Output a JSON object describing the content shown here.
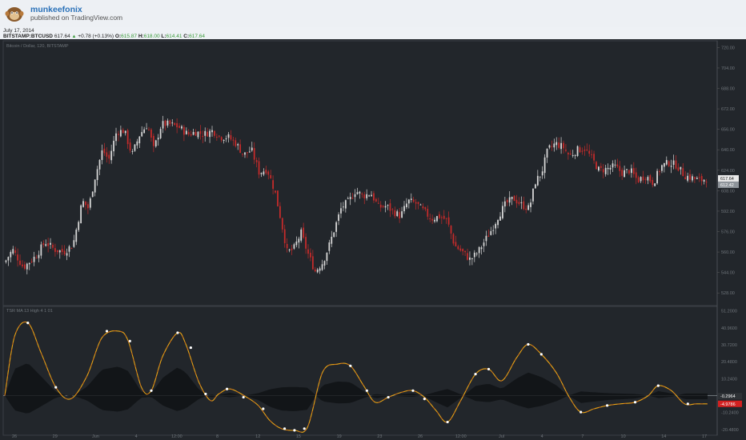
{
  "header": {
    "author": "munkeefonix",
    "published": "published on TradingView.com",
    "date": "July 17, 2014"
  },
  "quote": {
    "symbol": "BITSTAMP:BTCUSD",
    "last": "617.64",
    "change": "+0.78 (+0.13%)",
    "o_label": "O:",
    "o": "615.87",
    "h_label": "H:",
    "h": "618.00",
    "l_label": "L:",
    "l": "614.41",
    "c_label": "C:",
    "c": "617.64"
  },
  "colors": {
    "background": "#22262b",
    "up_candle": "#d6d6d6",
    "down_candle": "#c42b2b",
    "indicator_line": "#e8a415",
    "indicator_marker": "#ffffff",
    "price_tag": "#e9e9e9",
    "negative_tag": "#d22020"
  },
  "chart_data": [
    {
      "type": "candlestick",
      "title": "Bitcoin / Dollar, 120, BITSTAMP",
      "y_tick_labels": [
        "720.00",
        "704.00",
        "688.00",
        "672.00",
        "656.00",
        "640.00",
        "624.00",
        "608.00",
        "592.00",
        "576.00",
        "560.00",
        "544.00",
        "528.00"
      ],
      "ylim": [
        520,
        724
      ],
      "last_price_label": "617.64",
      "secondary_price_label": "612.42",
      "x_tick_labels": [
        "26",
        "29",
        "Jun",
        "4",
        "12:00",
        "8",
        "12",
        "15",
        "19",
        "23",
        "26",
        "12:00",
        "Jul",
        "4",
        "7",
        "10",
        "14",
        "17"
      ],
      "close_path": [
        [
          0,
          552
        ],
        [
          0.5,
          562
        ],
        [
          1.2,
          548
        ],
        [
          2,
          557
        ],
        [
          2.6,
          568
        ],
        [
          3.2,
          562
        ],
        [
          3.8,
          560
        ],
        [
          4.4,
          566
        ],
        [
          5,
          600
        ],
        [
          5.4,
          594
        ],
        [
          5.8,
          618
        ],
        [
          6.3,
          640
        ],
        [
          6.7,
          632
        ],
        [
          7.2,
          654
        ],
        [
          7.7,
          655
        ],
        [
          8.2,
          636
        ],
        [
          8.7,
          652
        ],
        [
          9.2,
          660
        ],
        [
          9.6,
          640
        ],
        [
          10.1,
          660
        ],
        [
          10.6,
          660
        ],
        [
          11.2,
          658
        ],
        [
          11.8,
          652
        ],
        [
          12.3,
          654
        ],
        [
          12.8,
          652
        ],
        [
          13.4,
          655
        ],
        [
          13.9,
          650
        ],
        [
          14.4,
          650
        ],
        [
          14.9,
          645
        ],
        [
          15.4,
          636
        ],
        [
          15.9,
          640
        ],
        [
          16.4,
          622
        ],
        [
          16.9,
          625
        ],
        [
          17.4,
          608
        ],
        [
          17.8,
          585
        ],
        [
          18.2,
          560
        ],
        [
          18.6,
          562
        ],
        [
          19.1,
          575
        ],
        [
          19.5,
          560
        ],
        [
          20,
          545
        ],
        [
          20.5,
          552
        ],
        [
          20.9,
          565
        ],
        [
          21.3,
          580
        ],
        [
          21.7,
          595
        ],
        [
          22.2,
          600
        ],
        [
          22.6,
          608
        ],
        [
          23.1,
          604
        ],
        [
          23.6,
          606
        ],
        [
          24.1,
          595
        ],
        [
          24.6,
          596
        ],
        [
          25,
          592
        ],
        [
          25.5,
          588
        ],
        [
          26,
          600
        ],
        [
          26.5,
          598
        ],
        [
          27,
          592
        ],
        [
          27.5,
          586
        ],
        [
          28,
          588
        ],
        [
          28.5,
          585
        ],
        [
          29,
          565
        ],
        [
          29.5,
          560
        ],
        [
          30,
          554
        ],
        [
          30.5,
          560
        ],
        [
          30.9,
          568
        ],
        [
          31.4,
          578
        ],
        [
          31.8,
          588
        ],
        [
          32.3,
          598
        ],
        [
          32.8,
          602
        ],
        [
          33.3,
          597
        ],
        [
          33.8,
          594
        ],
        [
          34.2,
          615
        ],
        [
          34.6,
          622
        ],
        [
          35,
          640
        ],
        [
          35.5,
          645
        ],
        [
          36,
          642
        ],
        [
          36.4,
          635
        ],
        [
          36.9,
          640
        ],
        [
          37.4,
          641
        ],
        [
          37.9,
          632
        ],
        [
          38.3,
          624
        ],
        [
          38.8,
          625
        ],
        [
          39.3,
          627
        ],
        [
          39.8,
          622
        ],
        [
          40.3,
          624
        ],
        [
          40.8,
          616
        ],
        [
          41.3,
          620
        ],
        [
          41.8,
          614
        ],
        [
          42.3,
          627
        ],
        [
          42.8,
          630
        ],
        [
          43.3,
          628
        ],
        [
          43.8,
          620
        ],
        [
          44.3,
          618
        ],
        [
          44.8,
          616
        ],
        [
          45.3,
          617.64
        ]
      ],
      "annotations": [
        "Bitcoin / Dollar, 120, BITSTAMP"
      ]
    },
    {
      "type": "line",
      "title": "TSR MA 13 High 4 1 01",
      "y_tick_labels": [
        "51.2000",
        "40.9600",
        "30.7200",
        "20.4800",
        "10.2400",
        "0.0000",
        "-10.2400",
        "-20.4800"
      ],
      "ylim": [
        -23.0,
        53.0
      ],
      "last_value_label": "-0.2964",
      "secondary_value_label": "-4.9786",
      "series": [
        {
          "values": [
            [
              0,
              0
            ],
            [
              0.6,
              36
            ],
            [
              1.4,
              44
            ],
            [
              2.2,
              26
            ],
            [
              3.1,
              5
            ],
            [
              4,
              -2
            ],
            [
              5.0,
              12
            ],
            [
              5.9,
              35
            ],
            [
              6.9,
              39
            ],
            [
              7.5,
              33
            ],
            [
              8.3,
              5
            ],
            [
              8.9,
              3
            ],
            [
              9.6,
              24
            ],
            [
              10.5,
              38
            ],
            [
              11,
              31
            ],
            [
              11.8,
              8
            ],
            [
              12.5,
              -3
            ],
            [
              13,
              1
            ],
            [
              13.7,
              4
            ],
            [
              14.7,
              -1
            ],
            [
              15.4,
              -6
            ],
            [
              16.1,
              -15
            ],
            [
              16.8,
              -20
            ],
            [
              17.6,
              -21
            ],
            [
              18.4,
              -19
            ],
            [
              19.3,
              14
            ],
            [
              20.2,
              19
            ],
            [
              21,
              18
            ],
            [
              21.8,
              6
            ],
            [
              22.5,
              -4
            ],
            [
              23.3,
              -1
            ],
            [
              24.1,
              2
            ],
            [
              24.8,
              3
            ],
            [
              25.5,
              -1
            ],
            [
              26.2,
              -9
            ],
            [
              26.9,
              -16
            ],
            [
              27.7,
              -3
            ],
            [
              28.6,
              13
            ],
            [
              29.4,
              16
            ],
            [
              30.2,
              9
            ],
            [
              31.1,
              23
            ],
            [
              31.8,
              31
            ],
            [
              32.6,
              25
            ],
            [
              33.5,
              14
            ],
            [
              34.3,
              -1
            ],
            [
              35,
              -10
            ],
            [
              35.8,
              -8
            ],
            [
              36.6,
              -6
            ],
            [
              37.4,
              -5
            ],
            [
              38.3,
              -4
            ],
            [
              39.1,
              0
            ],
            [
              39.7,
              6
            ],
            [
              40.5,
              3
            ],
            [
              41.3,
              -5
            ],
            [
              42,
              -5
            ],
            [
              42.7,
              -4.98
            ]
          ],
          "markers": [
            [
              1.4,
              44
            ],
            [
              3.1,
              5
            ],
            [
              6.2,
              39
            ],
            [
              7.6,
              33
            ],
            [
              8.9,
              3
            ],
            [
              10.5,
              38
            ],
            [
              11.3,
              29
            ],
            [
              12.2,
              1
            ],
            [
              13.5,
              4
            ],
            [
              14.5,
              -1
            ],
            [
              15.7,
              -8
            ],
            [
              17,
              -20
            ],
            [
              17.6,
              -21
            ],
            [
              18.2,
              -20
            ],
            [
              21,
              18
            ],
            [
              22,
              3
            ],
            [
              23.3,
              -1
            ],
            [
              24.8,
              3
            ],
            [
              25.5,
              -2
            ],
            [
              26.9,
              -16
            ],
            [
              28.6,
              13
            ],
            [
              29.4,
              16
            ],
            [
              31.8,
              31
            ],
            [
              32.6,
              25
            ],
            [
              35,
              -10
            ],
            [
              36.6,
              -6
            ],
            [
              38.3,
              -4
            ],
            [
              39.7,
              6
            ],
            [
              41.5,
              -5
            ]
          ]
        }
      ],
      "shadow_series_present": true
    }
  ]
}
